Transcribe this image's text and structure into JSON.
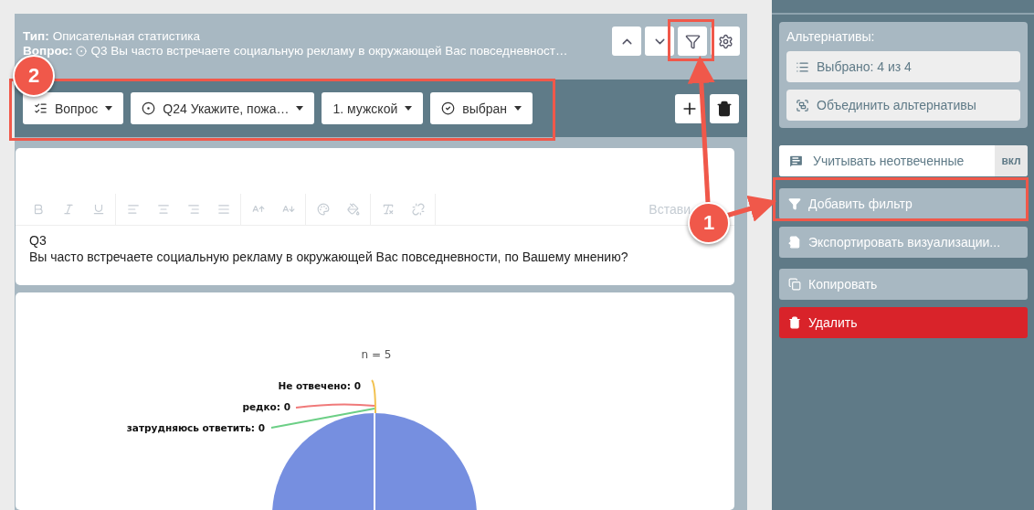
{
  "header": {
    "type_label": "Тип:",
    "type_value": "Описательная статистика",
    "question_label": "Вопрос:",
    "question_value": "Q3 Вы часто встречаете социальную рекламу в окружающей Вас повседневност…"
  },
  "header_buttons": [
    {
      "kind": "up"
    },
    {
      "kind": "down"
    },
    {
      "kind": "filter"
    },
    {
      "kind": "settings"
    }
  ],
  "filter_row": {
    "dropdowns": [
      {
        "kind": "question-type",
        "label": "Вопрос"
      },
      {
        "kind": "radio",
        "label": "Q24 Укажите, пожа…"
      },
      {
        "kind": "plain",
        "label": "1. мужской"
      },
      {
        "kind": "check",
        "label": "выбран"
      }
    ],
    "actions": [
      {
        "kind": "add"
      },
      {
        "kind": "delete"
      }
    ]
  },
  "editor": {
    "toolbar": [
      {
        "kind": "bold"
      },
      {
        "kind": "italic"
      },
      {
        "kind": "underline"
      },
      {
        "kind": "sep"
      },
      {
        "kind": "align-left"
      },
      {
        "kind": "align-center"
      },
      {
        "kind": "align-right"
      },
      {
        "kind": "align-justify"
      },
      {
        "kind": "sep"
      },
      {
        "kind": "size-up"
      },
      {
        "kind": "size-down"
      },
      {
        "kind": "sep"
      },
      {
        "kind": "palette"
      },
      {
        "kind": "fill"
      },
      {
        "kind": "sep"
      },
      {
        "kind": "clear"
      },
      {
        "kind": "unlink"
      },
      {
        "kind": "sep"
      }
    ],
    "toolbar_disabled": true,
    "insert_label": "Встави",
    "lines": [
      "Q3",
      "Вы часто встречаете социальную рекламу в окружающей Вас повседневности, по Вашему мнению?"
    ]
  },
  "chart": {
    "n_label": "n = 5",
    "labels": [
      {
        "text": "Не отвечено: 0",
        "color": "#f2c14e"
      },
      {
        "text": "редко: 0",
        "color": "#f07a7a"
      },
      {
        "text": "затрудняюсь ответить: 0",
        "color": "#6ccf86"
      }
    ]
  },
  "sidebar": {
    "group_title": "Альтернативы:",
    "group_buttons": [
      {
        "kind": "list",
        "label": "Выбрано: 4 из 4"
      },
      {
        "kind": "merge",
        "label": "Объединить альтернативы"
      }
    ],
    "toggle": {
      "label": "Учитывать неотвеченные",
      "state_label": "вкл",
      "on": true
    },
    "buttons": [
      {
        "kind": "filter",
        "label": "Добавить фильтр"
      },
      {
        "kind": "export",
        "label": "Экспортировать визуализации..."
      },
      {
        "kind": "copy",
        "label": "Копировать"
      },
      {
        "kind": "delete",
        "label": "Удалить"
      }
    ]
  },
  "callouts": [
    {
      "number": "1"
    },
    {
      "number": "2"
    }
  ]
}
